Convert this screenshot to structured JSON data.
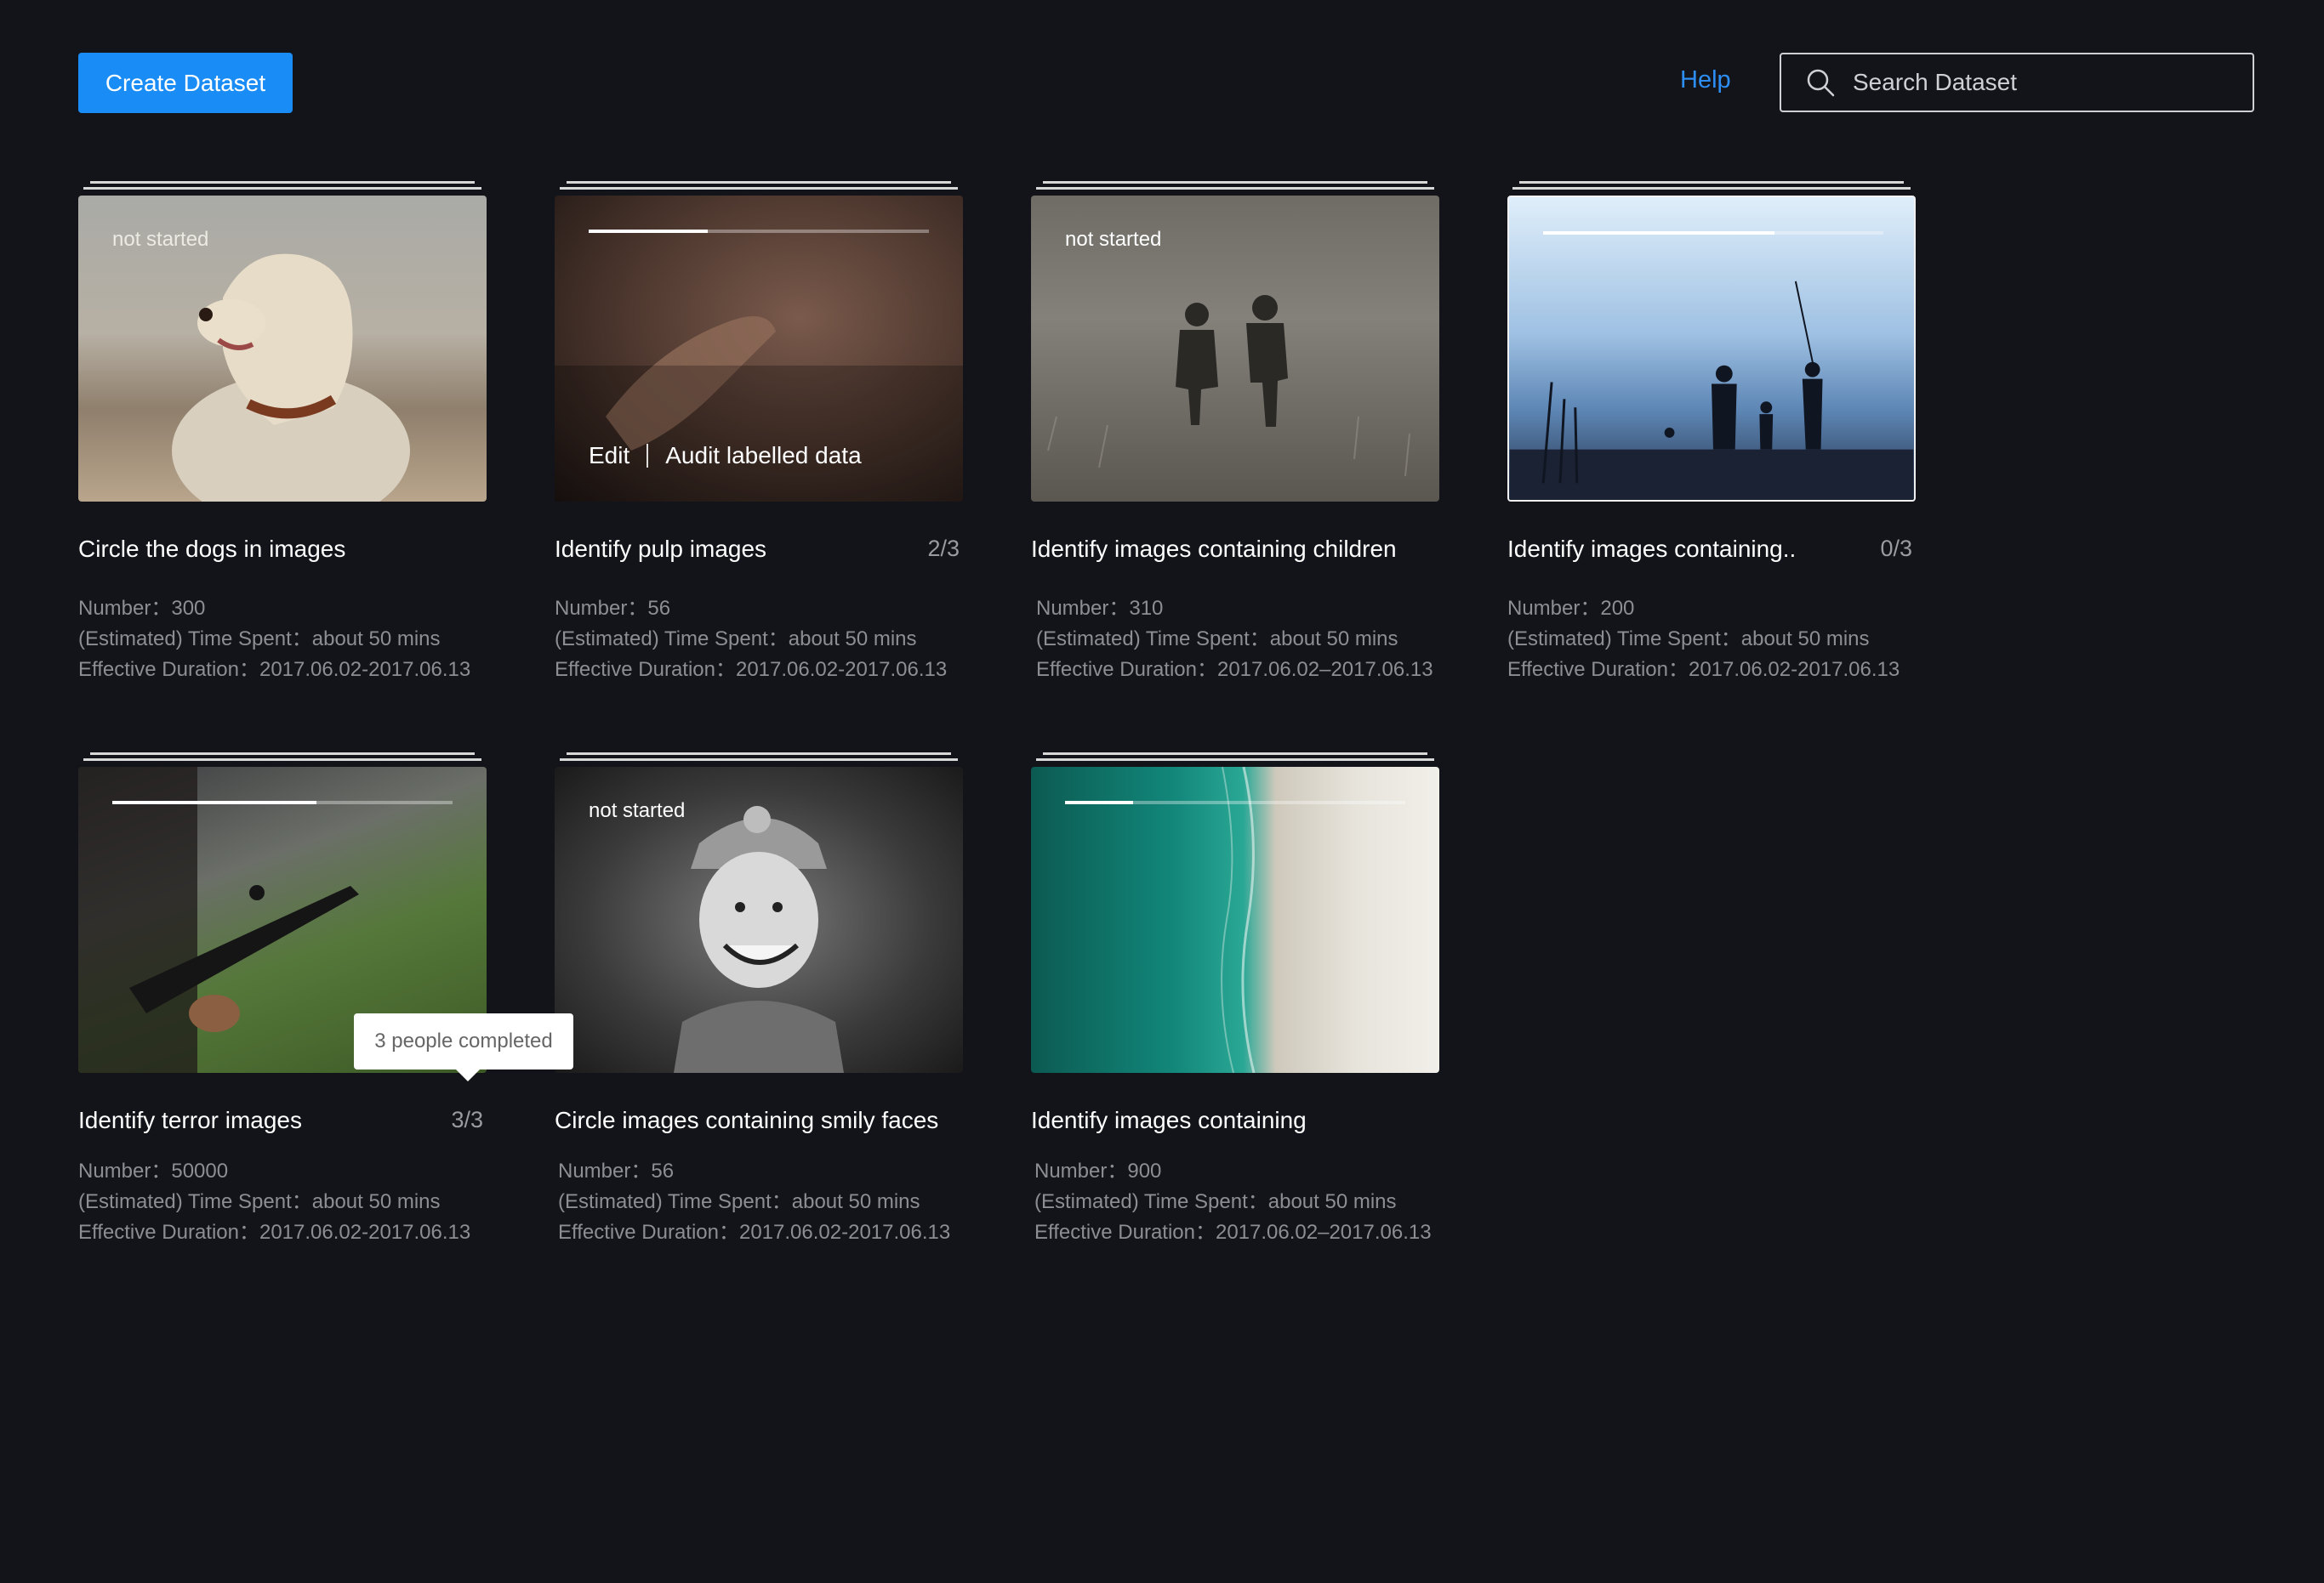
{
  "header": {
    "create_label": "Create Dataset",
    "help_label": "Help",
    "search_placeholder": "Search Dataset"
  },
  "colors": {
    "background": "#131419",
    "accent": "#1a8cf5",
    "link": "#2d8ff5"
  },
  "cards": [
    {
      "title": "Circle the dogs in images",
      "count": "",
      "status": "not started",
      "number": "Number：300",
      "time": "(Estimated) Time Spent：about 50 mins",
      "duration": "Effective Duration：2017.06.02-2017.06.13"
    },
    {
      "title": "Identify pulp images",
      "count": "2/3",
      "progress": 0.35,
      "edit_label": "Edit",
      "audit_label": "Audit labelled data",
      "number": "Number：56",
      "time": "(Estimated) Time Spent：about 50 mins",
      "duration": "Effective Duration：2017.06.02-2017.06.13"
    },
    {
      "title": "Identify images containing children",
      "count": "",
      "status": "not started",
      "number": "Number：310",
      "time": "(Estimated) Time Spent：about 50 mins",
      "duration": "Effective Duration：2017.06.02–2017.06.13"
    },
    {
      "title": "Identify images containing..",
      "count": "0/3",
      "progress": 0.68,
      "number": "Number：200",
      "time": "(Estimated) Time Spent：about 50 mins",
      "duration": "Effective Duration：2017.06.02-2017.06.13"
    },
    {
      "title": "Identify terror images",
      "count": "3/3",
      "progress": 0.6,
      "number": "Number：50000",
      "time": "(Estimated) Time Spent：about 50 mins",
      "duration": "Effective Duration：2017.06.02-2017.06.13"
    },
    {
      "title": "Circle images containing smily faces",
      "count": "",
      "status": "not started",
      "number": "Number：56",
      "time": "(Estimated) Time Spent：about 50 mins",
      "duration": "Effective Duration：2017.06.02-2017.06.13"
    },
    {
      "title": "Identify images containing",
      "count": "",
      "progress": 0.2,
      "number": "Number：900",
      "time": "(Estimated) Time Spent：about 50 mins",
      "duration": "Effective Duration：2017.06.02–2017.06.13"
    }
  ],
  "tooltip": {
    "text": "3 people completed"
  }
}
